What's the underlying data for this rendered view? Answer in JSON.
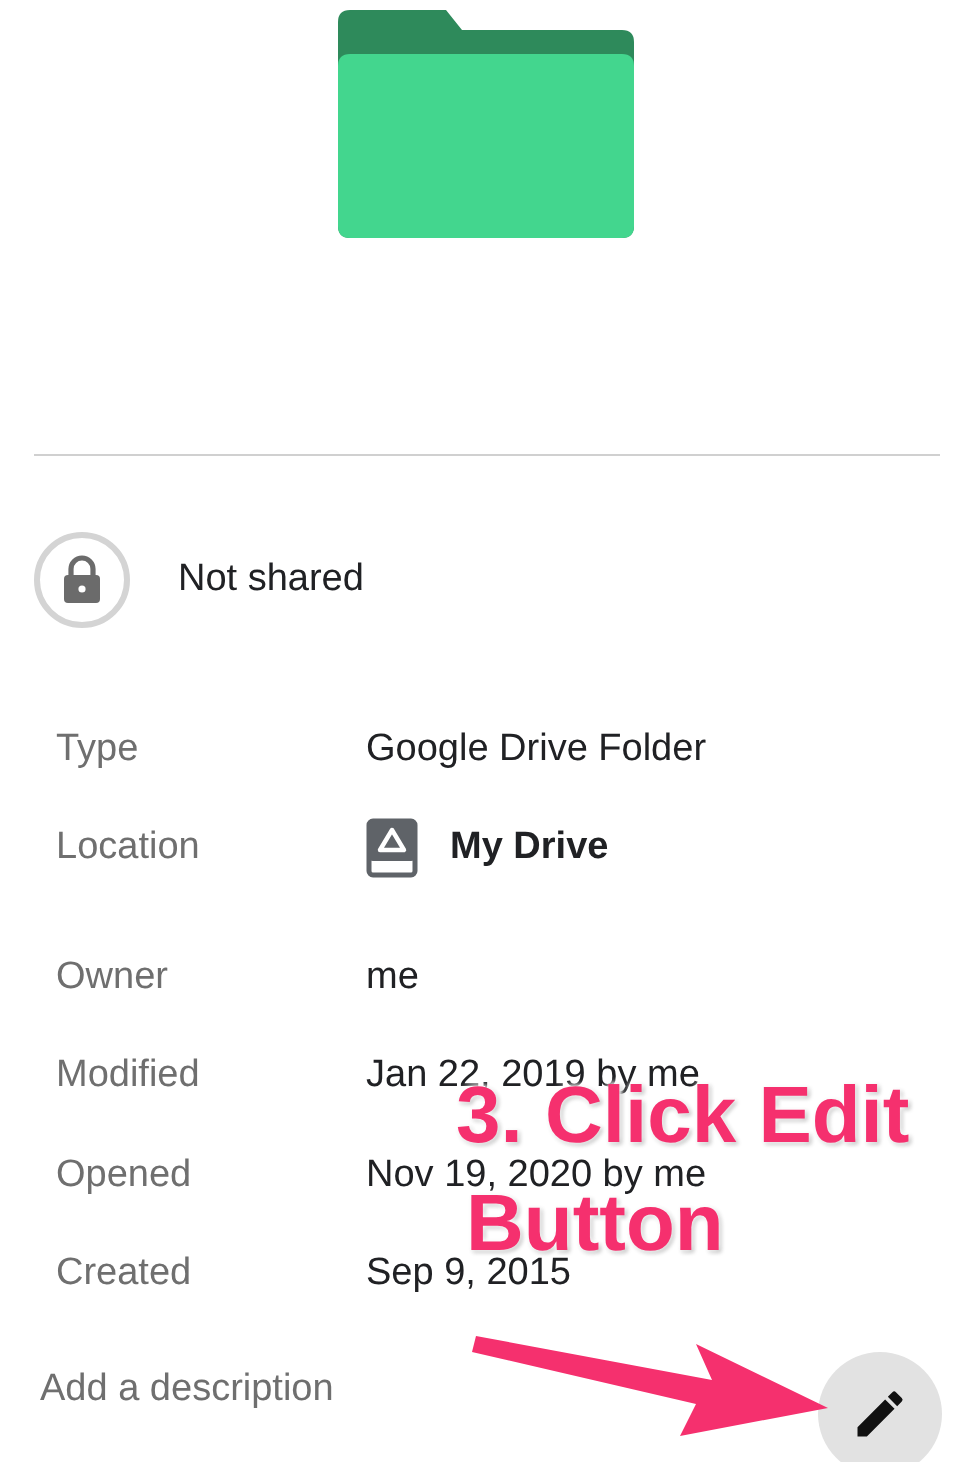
{
  "sharing": {
    "label": "Not shared"
  },
  "details": [
    {
      "label": "Type",
      "value": "Google Drive Folder",
      "kind": "text"
    },
    {
      "label": "Location",
      "value": "My Drive",
      "kind": "location"
    },
    {
      "label": "Owner",
      "value": "me",
      "kind": "text"
    },
    {
      "label": "Modified",
      "value": "Jan 22, 2019 by me",
      "kind": "text"
    },
    {
      "label": "Opened",
      "value": "Nov 19, 2020 by me",
      "kind": "text"
    },
    {
      "label": "Created",
      "value": "Sep 9, 2015",
      "kind": "text"
    }
  ],
  "description": {
    "placeholder": "Add a description"
  },
  "annotation": {
    "lines": [
      "3. Click Edit",
      "Button"
    ]
  }
}
